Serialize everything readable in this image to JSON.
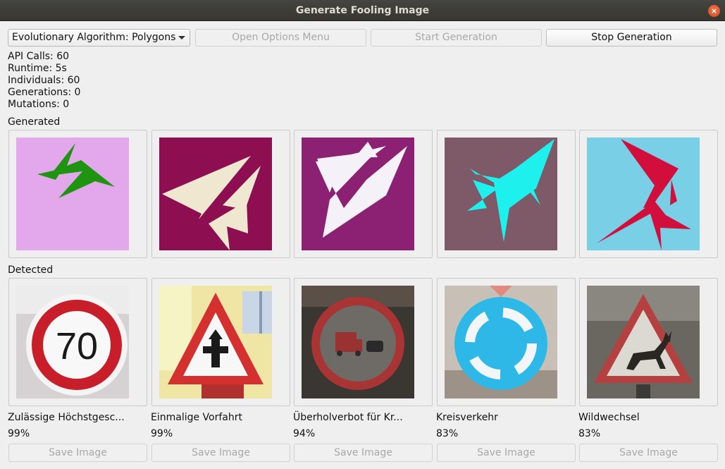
{
  "window": {
    "title": "Generate Fooling Image",
    "close_glyph": "×"
  },
  "toolbar": {
    "algorithm_select": "Evolutionary Algorithm: Polygons",
    "options_label": "Open Options Menu",
    "start_label": "Start Generation",
    "stop_label": "Stop Generation"
  },
  "stats": {
    "api_calls": "API Calls: 60",
    "runtime": "Runtime: 5s",
    "individuals": "Individuals: 60",
    "generations": "Generations: 0",
    "mutations": "Mutations: 0"
  },
  "sections": {
    "generated": "Generated",
    "detected": "Detected"
  },
  "generated": [
    {
      "bg": "#e3a8ec",
      "fg": "#1e9410",
      "icon": "polygon-image"
    },
    {
      "bg": "#8d0f52",
      "fg": "#efe7cf",
      "icon": "polygon-image"
    },
    {
      "bg": "#8c2072",
      "fg": "#f4f1f8",
      "icon": "polygon-image"
    },
    {
      "bg": "#7e5a68",
      "fg": "#1ef0ee",
      "icon": "polygon-image"
    },
    {
      "bg": "#79cfe6",
      "fg": "#d20f3c",
      "icon": "polygon-image"
    }
  ],
  "detected": [
    {
      "name": "Zulässige Höchstgesc...",
      "confidence": "99%",
      "save_label": "Save Image",
      "sign_text": "70",
      "icon": "speed-limit-sign"
    },
    {
      "name": "Einmalige Vorfahrt",
      "confidence": "99%",
      "save_label": "Save Image",
      "icon": "priority-sign"
    },
    {
      "name": "Überholverbot für Kr...",
      "confidence": "94%",
      "save_label": "Save Image",
      "icon": "no-overtaking-trucks-sign"
    },
    {
      "name": "Kreisverkehr",
      "confidence": "83%",
      "save_label": "Save Image",
      "icon": "roundabout-sign"
    },
    {
      "name": "Wildwechsel",
      "confidence": "83%",
      "save_label": "Save Image",
      "icon": "deer-crossing-sign"
    }
  ],
  "colors": {
    "titlebar": "#3c3b37",
    "close": "#e95420",
    "window_bg": "#efefef"
  }
}
